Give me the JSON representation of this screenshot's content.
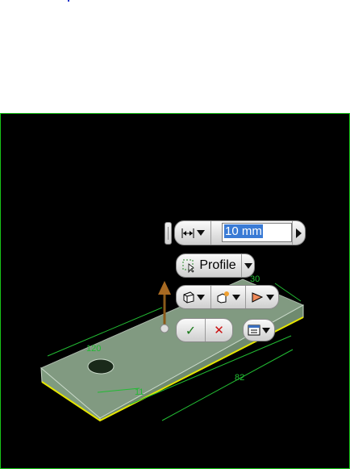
{
  "viewport": {
    "dimensions": {
      "length": "120",
      "width": "30",
      "hole_offset": "82",
      "hole_label": "11"
    }
  },
  "minitoolbar": {
    "distance_value": "10 mm",
    "profile_label": "Profile",
    "ok_symbol": "✓",
    "cancel_symbol": "✕"
  },
  "colors": {
    "viewport_bg": "#000000",
    "viewport_border": "#19c419",
    "part_face": "#a8c2a8",
    "edge_highlight": "#e6e600",
    "dimension": "#22bb33",
    "arrow": "#8b5a1a"
  }
}
